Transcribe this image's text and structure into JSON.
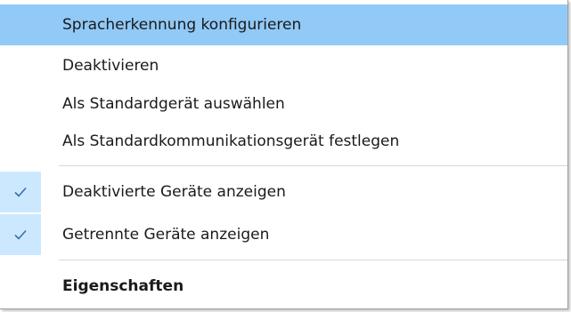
{
  "menu": {
    "items": [
      {
        "label": "Spracherkennung konfigurieren"
      },
      {
        "label": "Deaktivieren"
      },
      {
        "label": "Als Standardgerät auswählen"
      },
      {
        "label": "Als Standardkommunikationsgerät festlegen"
      },
      {
        "label": "Deaktivierte Geräte anzeigen",
        "checked": true
      },
      {
        "label": "Getrennte Geräte anzeigen",
        "checked": true
      },
      {
        "label": "Eigenschaften",
        "bold": true
      }
    ],
    "highlight_color": "#91c9f7",
    "check_background": "#cce8ff",
    "check_color": "#3b6ea8"
  }
}
